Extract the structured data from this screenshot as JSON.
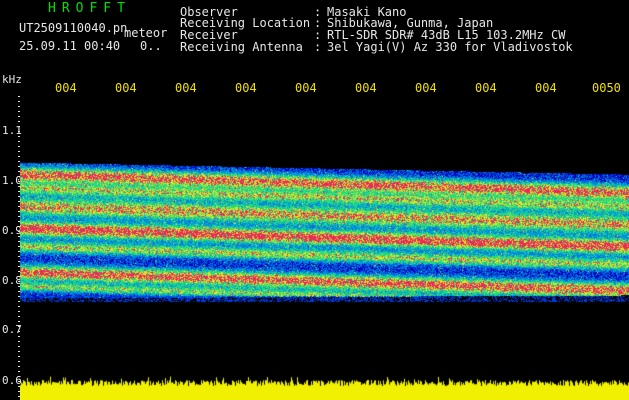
{
  "header": {
    "title": "HROFFT",
    "filename": "UT2509110040.pn",
    "meteor_label": "meteor",
    "datetime": "25.09.11 00:40",
    "dots": "0..",
    "fields": [
      {
        "label": "Observer",
        "value": "Masaki Kano"
      },
      {
        "label": "Receiving Location",
        "value": "Shibukawa, Gunma, Japan"
      },
      {
        "label": "Receiver",
        "value": "RTL-SDR SDR# 43dB L15 103.2MHz CW"
      },
      {
        "label": "Receiving Antenna",
        "value": "3el Yagi(V) Az 330 for Vladivostok"
      }
    ]
  },
  "axis": {
    "unit": "kHz",
    "y_ticks": [
      "1.1",
      "1.0",
      "0.9",
      "0.8",
      "0.7",
      "0.6"
    ],
    "x_ticks": [
      "004",
      "004",
      "004",
      "004",
      "004",
      "004",
      "004",
      "004",
      "004",
      "0050"
    ]
  },
  "colors": {
    "background": "#000000",
    "title": "#00e000",
    "text": "#e6e6e6",
    "ticks": "#f0e000",
    "noise_bar": "#f0f000"
  }
}
